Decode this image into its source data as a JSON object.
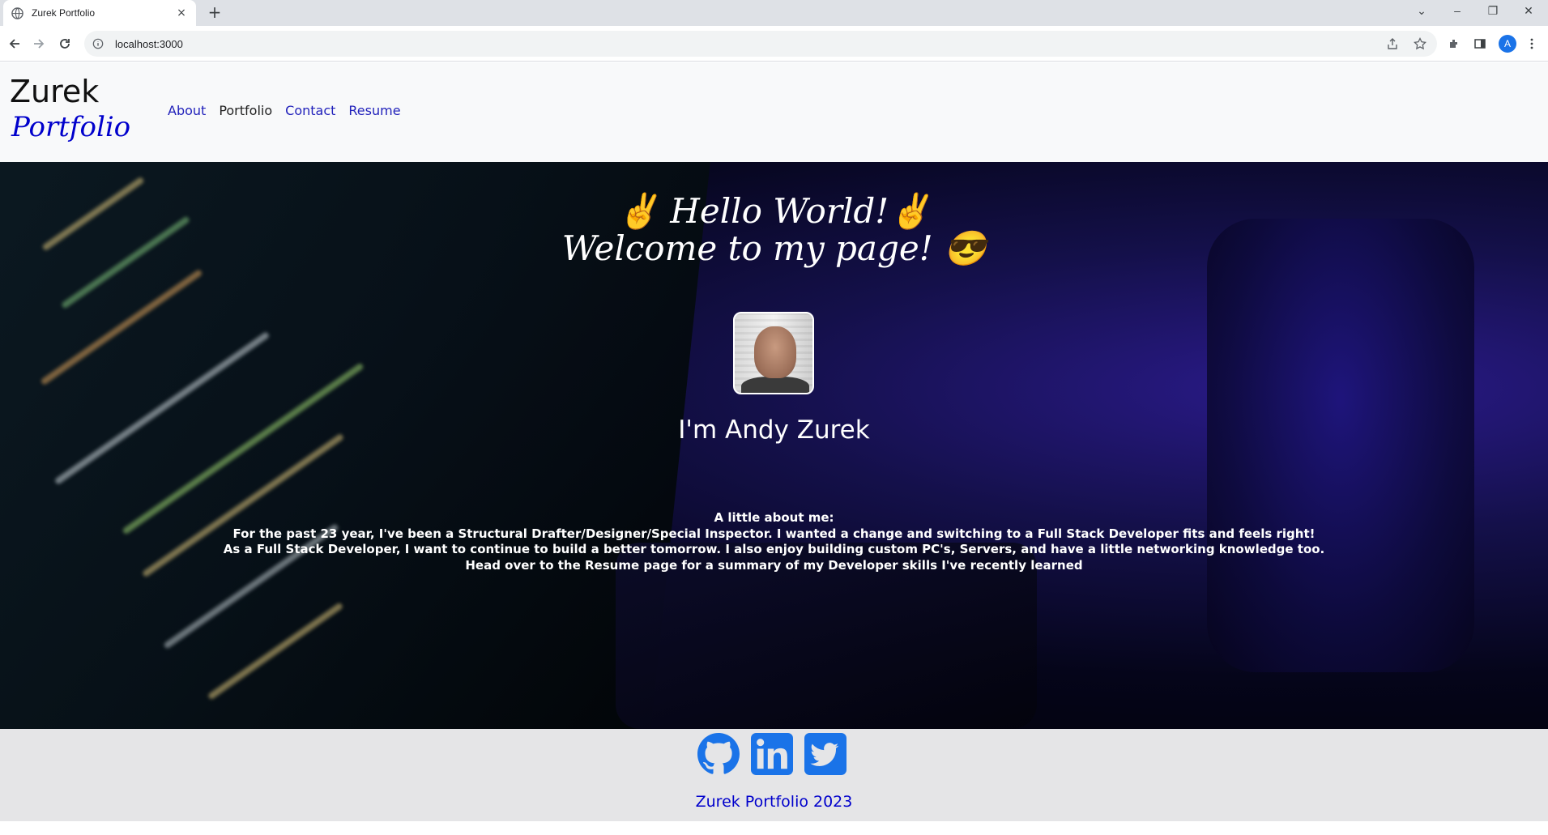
{
  "browser": {
    "tab_title": "Zurek Portfolio",
    "tab_close": "×",
    "new_tab": "+",
    "url": "localhost:3000",
    "profile_initial": "A",
    "window_controls": [
      "⌄",
      "–",
      "❐",
      "✕"
    ]
  },
  "header": {
    "brand_top": "Zurek",
    "brand_bottom": "Portfolio",
    "nav": [
      "About",
      "Portfolio",
      "Contact",
      "Resume"
    ],
    "active_nav": "Portfolio"
  },
  "hero": {
    "greeting_line1": "✌️ Hello World!✌️",
    "greeting_line2": "Welcome to my page! 😎",
    "name": "I'm Andy Zurek",
    "about_lines": [
      "A little about me:",
      "For the past 23 year, I've been a Structural Drafter/Designer/Special Inspector. I wanted a change and switching to a Full Stack Developer fits and feels right!",
      "As a Full Stack Developer, I want to continue to build a better tomorrow. I also enjoy building custom PC's, Servers, and have a little networking knowledge too.",
      "Head over to the Resume page for a summary of my Developer skills I've recently learned"
    ]
  },
  "footer": {
    "social": [
      "github-icon",
      "linkedin-icon",
      "twitter-icon"
    ],
    "text": "Zurek Portfolio 2023",
    "accent": "#1a73e8"
  }
}
